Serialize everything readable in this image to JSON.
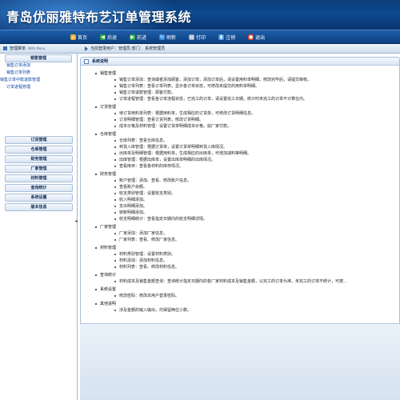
{
  "header": {
    "title": "青岛优丽雅特布艺订单管理系统"
  },
  "topnav": [
    {
      "label": "首页",
      "icon": "home-icon",
      "color": "#f0b030",
      "glyph": "⌂"
    },
    {
      "label": "后退",
      "icon": "back-icon",
      "color": "#2ea84a",
      "glyph": "◀"
    },
    {
      "label": "前进",
      "icon": "forward-icon",
      "color": "#2ea84a",
      "glyph": "▶"
    },
    {
      "label": "刷新",
      "icon": "refresh-icon",
      "color": "#3b8ee0",
      "glyph": "↻"
    },
    {
      "label": "打印",
      "icon": "print-icon",
      "color": "#8fa6c4",
      "glyph": "▤"
    },
    {
      "label": "注销",
      "icon": "logout-icon",
      "color": "#4a9be8",
      "glyph": "▮"
    },
    {
      "label": "退出",
      "icon": "exit-icon",
      "color": "#d83a2a",
      "glyph": "●"
    }
  ],
  "infobar": {
    "menu_title": "管理菜单",
    "menu_subtitle": "With Menu",
    "current_user": "当前登录用户：管理员  部门：  系统管理员"
  },
  "sidebar": {
    "sales_head": "销售管理",
    "sales_items": [
      "销售订单添加",
      "销售订单列表",
      "销售订单中款退款管理",
      "订单进程管理"
    ],
    "groups": [
      "订货管理",
      "仓库管理",
      "财务管理",
      "厂家管理",
      "材料管理",
      "查询统计",
      "系统设置",
      "版本信息"
    ]
  },
  "main": {
    "panel_title": "系统说明",
    "sections": [
      {
        "title": "销售管理",
        "items": [
          "销售订单添加：查询或者添加顾客，添加订单，添加订单后，请设置用料单明细，修改完毕后，请提交审核。",
          "销售订单列表：查看订单列表，显示各订单状态，可修改未提交的用料单明细。",
          "销售订单退款管理：顾客付款。",
          "订单进程管理：查看各订单流程状态，已完工的订单，请设置完工日期，统计时未完工的订单不计算在内。"
        ]
      },
      {
        "title": "订货管理",
        "items": [
          "待订货用料单列表：根据用料单，生成相应的订货单，可修改订货明细信息。",
          "订货明细管理：查看订货列表，修改订货明细。",
          "成本价格及材料管理：设置订货单明细成本价格，给厂家付款。"
        ]
      },
      {
        "title": "仓库管理",
        "items": [
          "仓库列表：查看仓库信息。",
          "到货入库管理：根据订货单，设置订货单明细到货入库情况。",
          "出库单及明细管理：根据用料单，生成相应的出库单，可增加减料等明细。",
          "出库管理：根据出库单，设置出库单明细的出库情况。",
          "查看库存：查看各材料的库存情况。"
        ]
      },
      {
        "title": "财务管理",
        "items": [
          "账户管理：添加、查看、修改账户信息。",
          "查看账户余额。",
          "收支类别管理：设置收支类别。",
          "收入明细添加。",
          "支出明细添加。",
          "转账明细添加。",
          "收支明细统计：查看指定日期内的收支明细详情。"
        ]
      },
      {
        "title": "厂家管理",
        "items": [
          "厂家添加：添加厂家信息。",
          "厂家列表：查看、修改厂家信息。"
        ]
      },
      {
        "title": "材料管理",
        "items": [
          "材料类别管理：设置材料类别。",
          "材料添加：添加材料信息。",
          "材料列表：查看、修改材料信息。"
        ]
      },
      {
        "title": "查询统计",
        "items": [
          "材料成本及销售金额查询：查询统计指定日期内的各厂家材料成本及销售金额，以完工的订单为准，未完工的订单不统计，可按..."
        ]
      },
      {
        "title": "系统设置",
        "items": [
          "修改密码：修改本用户登录密码。"
        ]
      },
      {
        "title": "其他说明",
        "items": [
          "涉及金额的输入输出，均保留两位小数。"
        ]
      }
    ]
  }
}
